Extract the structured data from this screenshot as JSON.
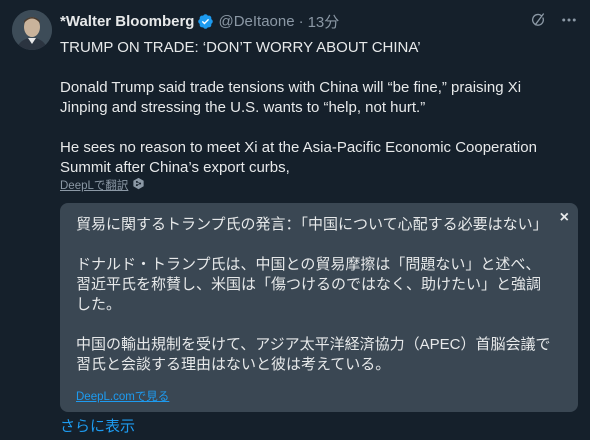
{
  "tweet": {
    "author_name": "*Walter Bloomberg",
    "handle": "@DeItaone",
    "separator": "·",
    "time": "13分",
    "paragraphs": [
      "TRUMP ON TRADE: ‘DON’T WORRY ABOUT CHINA’",
      "Donald Trump said trade tensions with China will “be fine,” praising Xi Jinping and stressing the U.S. wants to “help, not hurt.”",
      "He sees no reason to meet Xi at the Asia-Pacific Economic Cooperation Summit after China’s export curbs,"
    ],
    "translate_label": "DeepLで翻訳",
    "show_more": "さらに表示"
  },
  "translation": {
    "close_glyph": "×",
    "paragraphs": [
      "貿易に関するトランプ氏の発言：「中国について心配する必要はない」",
      "ドナルド・トランプ氏は、中国との貿易摩擦は「問題ない」と述べ、習近平氏を称賛し、米国は「傷つけるのではなく、助けたい」と強調した。",
      "中国の輸出規制を受けて、アジア太平洋経済協力（APEC）首脳会議で習氏と会談する理由はないと彼は考えている。"
    ],
    "link_label": "DeepL.comで見る"
  },
  "icons": {
    "verified": "verified-badge-icon",
    "grok": "grok-icon",
    "more": "more-icon",
    "deepl": "deepl-icon"
  },
  "colors": {
    "background": "#15202b",
    "panel": "#3a4753",
    "text": "#e7e9ea",
    "muted": "#8b98a5",
    "accent": "#1d9bf0"
  }
}
